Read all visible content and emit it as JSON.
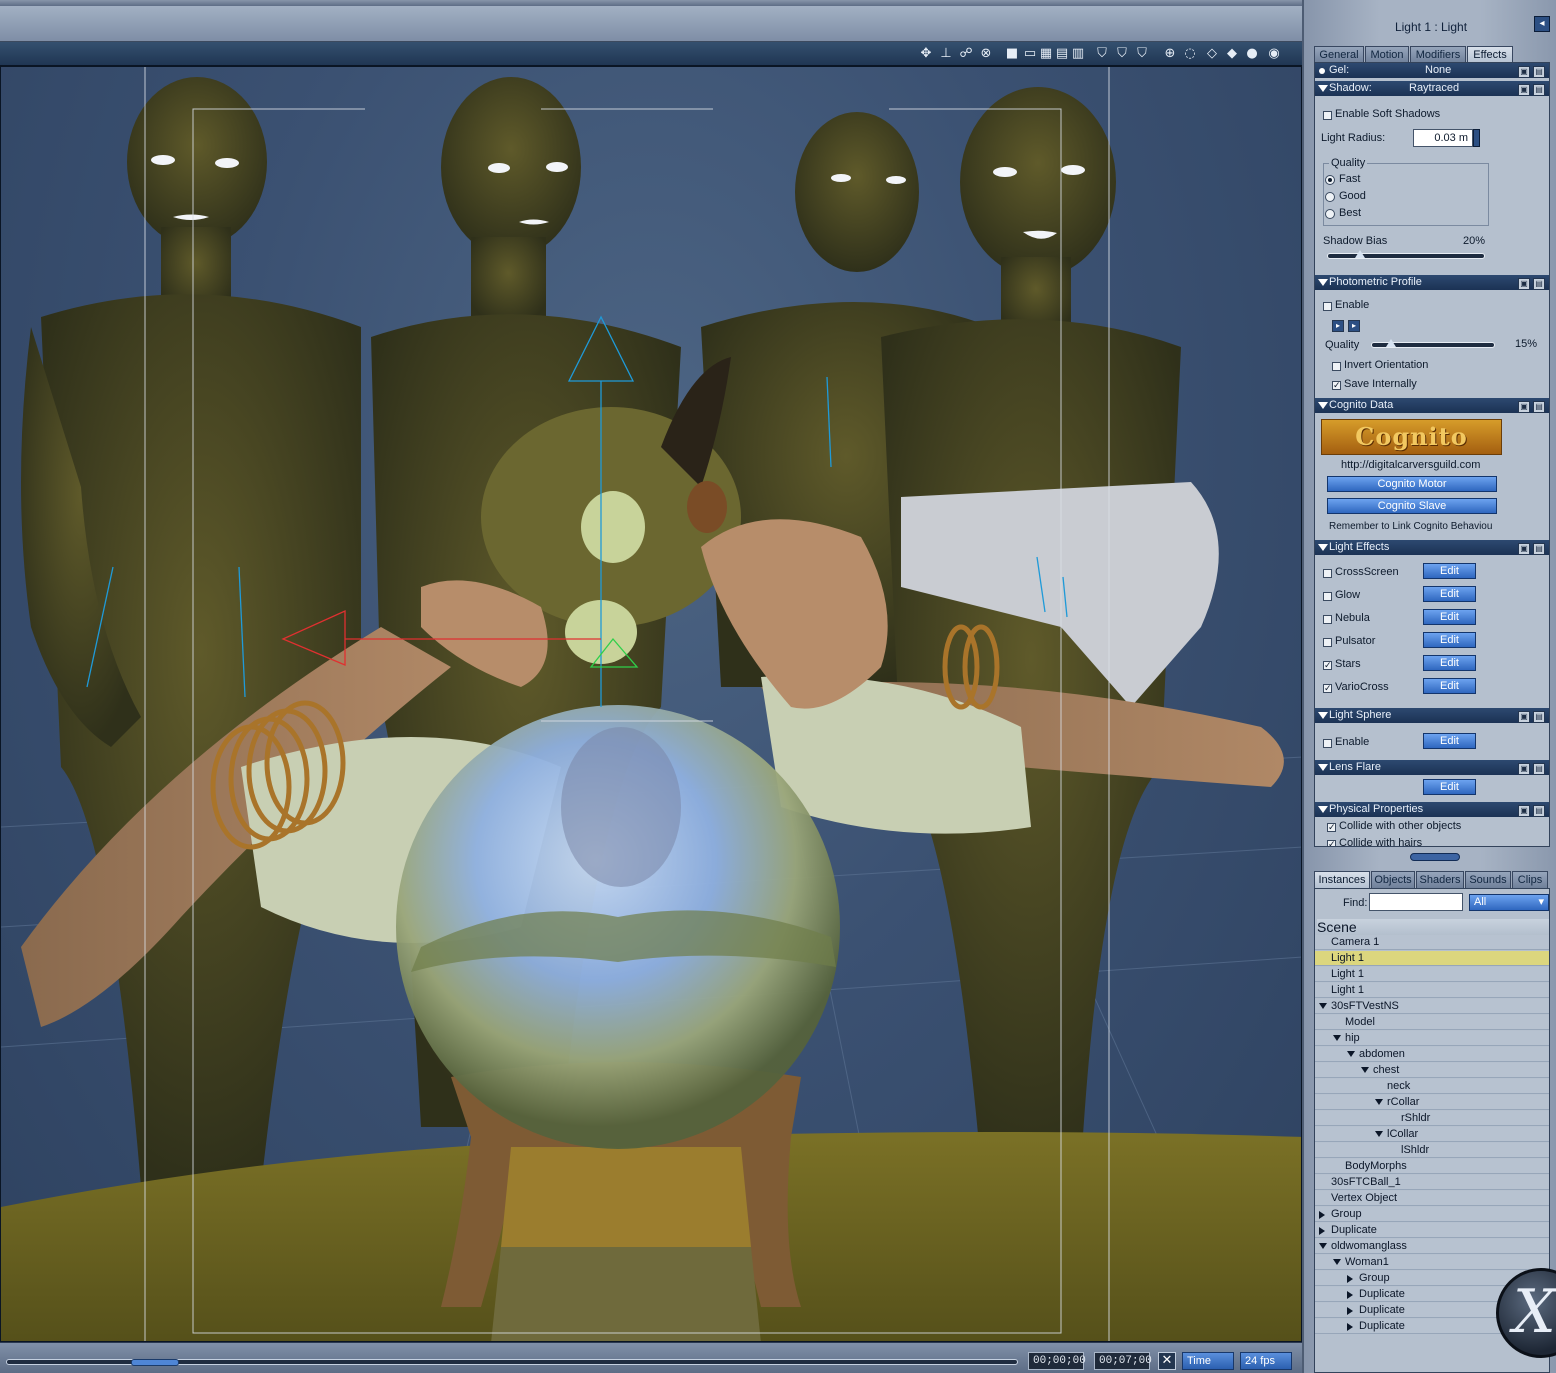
{
  "viewport": {
    "time_current": "00;00;00",
    "time_end": "00;07;00",
    "time_mode": "Time",
    "fps": "24 fps"
  },
  "panel": {
    "title": "Light 1 : Light",
    "tabs": [
      "General",
      "Motion",
      "Modifiers",
      "Effects"
    ],
    "active_tab": "Effects",
    "gel": {
      "label": "Gel:",
      "value": "None"
    },
    "shadow": {
      "label": "Shadow:",
      "value": "Raytraced",
      "soft_shadows": "Enable Soft Shadows",
      "light_radius_label": "Light Radius:",
      "light_radius": "0.03 m",
      "quality_label": "Quality",
      "quality_options": [
        "Fast",
        "Good",
        "Best"
      ],
      "quality_selected": "Fast",
      "bias_label": "Shadow Bias",
      "bias_value": "20%",
      "bias_fraction": 0.2
    },
    "photometric": {
      "title": "Photometric Profile",
      "enable": "Enable",
      "quality_label": "Quality",
      "quality_value": "15%",
      "quality_fraction": 0.15,
      "invert": "Invert Orientation",
      "save_internally": "Save Internally"
    },
    "cognito": {
      "title": "Cognito Data",
      "logo_text": "Cognito",
      "url": "http://digitalcarversguild.com",
      "motor_btn": "Cognito Motor",
      "slave_btn": "Cognito Slave",
      "note": "Remember to Link Cognito Behaviou"
    },
    "light_effects": {
      "title": "Light Effects",
      "items": [
        {
          "label": "CrossScreen",
          "checked": false,
          "edit": "Edit"
        },
        {
          "label": "Glow",
          "checked": false,
          "edit": "Edit"
        },
        {
          "label": "Nebula",
          "checked": false,
          "edit": "Edit"
        },
        {
          "label": "Pulsator",
          "checked": false,
          "edit": "Edit"
        },
        {
          "label": "Stars",
          "checked": true,
          "edit": "Edit"
        },
        {
          "label": "VarioCross",
          "checked": true,
          "edit": "Edit"
        }
      ]
    },
    "light_sphere": {
      "title": "Light Sphere",
      "enable": "Enable",
      "edit": "Edit"
    },
    "lens_flare": {
      "title": "Lens Flare",
      "edit": "Edit"
    },
    "physical": {
      "title": "Physical Properties",
      "collide_objects": "Collide with other objects",
      "collide_hairs": "Collide with hairs"
    }
  },
  "scene": {
    "tabs": [
      "Instances",
      "Objects",
      "Shaders",
      "Sounds",
      "Clips"
    ],
    "active_tab": "Instances",
    "find_label": "Find:",
    "find_value": "",
    "filter": "All",
    "header": "Scene",
    "items": [
      {
        "label": "Camera 1",
        "depth": 0,
        "arrow": ""
      },
      {
        "label": "Light 1",
        "depth": 0,
        "arrow": "",
        "selected": true
      },
      {
        "label": "Light 1",
        "depth": 0,
        "arrow": ""
      },
      {
        "label": "Light 1",
        "depth": 0,
        "arrow": ""
      },
      {
        "label": "30sFTVestNS",
        "depth": 0,
        "arrow": "down"
      },
      {
        "label": "Model",
        "depth": 1,
        "arrow": ""
      },
      {
        "label": "hip",
        "depth": 1,
        "arrow": "down"
      },
      {
        "label": "abdomen",
        "depth": 2,
        "arrow": "down"
      },
      {
        "label": "chest",
        "depth": 3,
        "arrow": "down"
      },
      {
        "label": "neck",
        "depth": 4,
        "arrow": ""
      },
      {
        "label": "rCollar",
        "depth": 4,
        "arrow": "down"
      },
      {
        "label": "rShldr",
        "depth": 5,
        "arrow": ""
      },
      {
        "label": "lCollar",
        "depth": 4,
        "arrow": "down"
      },
      {
        "label": "lShldr",
        "depth": 5,
        "arrow": ""
      },
      {
        "label": "BodyMorphs",
        "depth": 1,
        "arrow": ""
      },
      {
        "label": "30sFTCBall_1",
        "depth": 0,
        "arrow": ""
      },
      {
        "label": "Vertex Object",
        "depth": 0,
        "arrow": ""
      },
      {
        "label": "Group",
        "depth": 0,
        "arrow": "right"
      },
      {
        "label": "Duplicate",
        "depth": 0,
        "arrow": "right"
      },
      {
        "label": "oldwomanglass",
        "depth": 0,
        "arrow": "down"
      },
      {
        "label": "Woman1",
        "depth": 1,
        "arrow": "down"
      },
      {
        "label": "Group",
        "depth": 2,
        "arrow": "right"
      },
      {
        "label": "Duplicate",
        "depth": 2,
        "arrow": "right"
      },
      {
        "label": "Duplicate",
        "depth": 2,
        "arrow": "right"
      },
      {
        "label": "Duplicate",
        "depth": 2,
        "arrow": "right"
      }
    ]
  },
  "colors": {
    "selection": "#dcd67e",
    "accent_button": "#2f67bf",
    "section_header": "#1b3254"
  }
}
